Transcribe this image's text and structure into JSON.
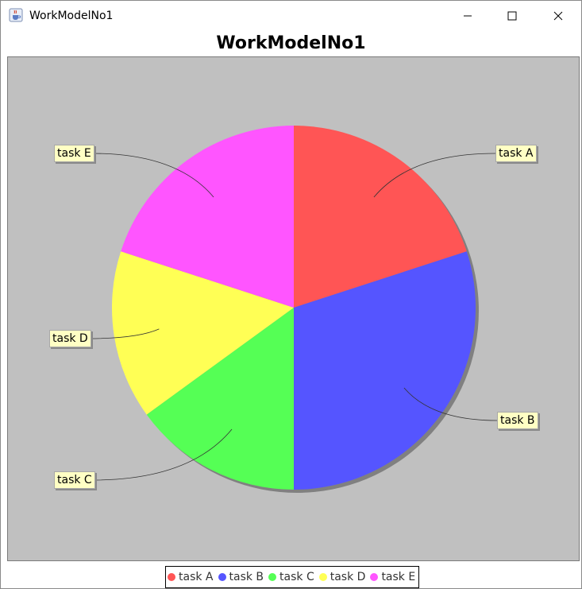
{
  "window": {
    "title": "WorkModelNo1",
    "icons": {
      "app": "java-cup-icon",
      "minimize": "minimize-icon",
      "maximize": "maximize-icon",
      "close": "close-icon"
    }
  },
  "chart_data": {
    "type": "pie",
    "title": "WorkModelNo1",
    "categories": [
      "task A",
      "task B",
      "task C",
      "task D",
      "task E"
    ],
    "values": [
      20,
      30,
      15,
      15,
      20
    ],
    "colors": [
      "#ff5555",
      "#5555ff",
      "#55ff55",
      "#ffff55",
      "#ff55ff"
    ],
    "legend_position": "bottom",
    "background": "#c0c0c0",
    "label_background": "#ffffc4"
  }
}
